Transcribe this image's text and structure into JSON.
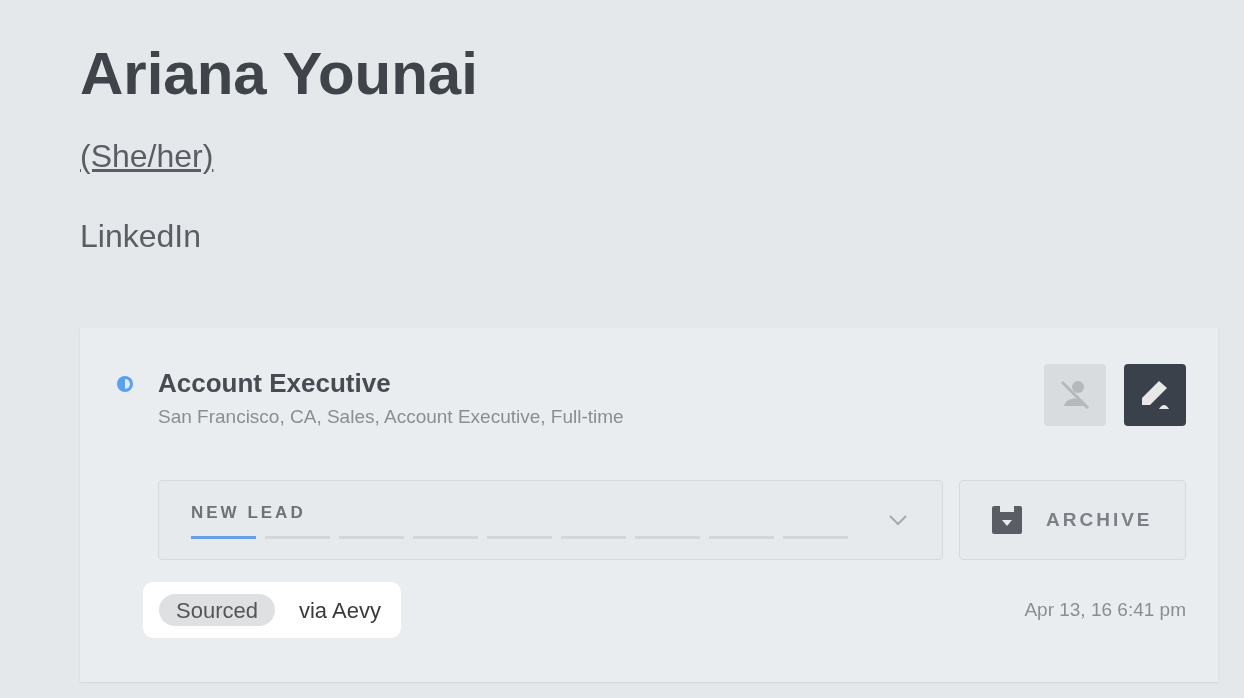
{
  "profile": {
    "name": "Ariana Younai",
    "pronouns": "(She/her)",
    "link": "LinkedIn"
  },
  "opportunity": {
    "title": "Account Executive",
    "details": "San Francisco, CA, Sales, Account Executive, Full-time",
    "stage": {
      "label": "NEW LEAD",
      "steps": [
        {
          "selected": true
        },
        {
          "selected": false
        },
        {
          "selected": false
        },
        {
          "selected": false
        },
        {
          "selected": false
        },
        {
          "selected": false
        },
        {
          "selected": false
        },
        {
          "selected": false
        },
        {
          "selected": false
        }
      ]
    },
    "archive_label": "ARCHIVE",
    "tag": "Sourced",
    "source": "via Aevy",
    "timestamp": "Apr 13, 16 6:41 pm"
  }
}
